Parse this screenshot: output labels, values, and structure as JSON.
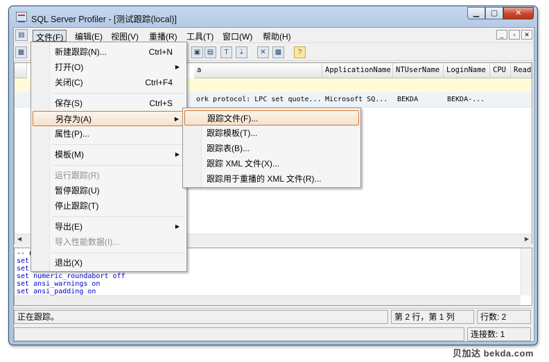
{
  "window": {
    "title": "SQL Server Profiler - [测试跟踪(local)]"
  },
  "menubar": {
    "items": [
      "文件(F)",
      "编辑(E)",
      "视图(V)",
      "重播(R)",
      "工具(T)",
      "窗口(W)",
      "帮助(H)"
    ]
  },
  "grid": {
    "columns": [
      "a",
      "ApplicationName",
      "NTUserName",
      "LoginName",
      "CPU",
      "Read"
    ],
    "row": [
      "ork protocol: LPC  set quote...",
      "Microsoft SQ...",
      "BEKDA",
      "BEKDA-..."
    ]
  },
  "text_pane": {
    "lines": [
      {
        "kw": "set",
        "rest": ""
      },
      {
        "kw": "set",
        "rest": ""
      },
      {
        "kw": "set",
        "rest": "numeric_roundabort off"
      },
      {
        "kw": "set",
        "rest": "ansi_warnings on"
      },
      {
        "kw": "set",
        "rest": "ansi_padding on"
      }
    ],
    "first_line": "-- n"
  },
  "status": {
    "text": "正在跟踪。",
    "position": "第 2 行，第 1 列",
    "rows": "行数: 2",
    "connections": "连接数: 1"
  },
  "file_menu": {
    "items": [
      {
        "label": "新建跟踪(N)...",
        "shortcut": "Ctrl+N"
      },
      {
        "label": "打开(O)",
        "shortcut": ""
      },
      {
        "label": "关闭(C)",
        "shortcut": "Ctrl+F4"
      },
      {
        "label": "保存(S)",
        "shortcut": "Ctrl+S"
      },
      {
        "label": "另存为(A)",
        "shortcut": ""
      },
      {
        "label": "属性(P)...",
        "shortcut": ""
      },
      {
        "label": "模板(M)",
        "shortcut": ""
      },
      {
        "label": "运行跟踪(R)",
        "shortcut": ""
      },
      {
        "label": "暂停跟踪(U)",
        "shortcut": ""
      },
      {
        "label": "停止跟踪(T)",
        "shortcut": ""
      },
      {
        "label": "导出(E)",
        "shortcut": ""
      },
      {
        "label": "导入性能数据(I)...",
        "shortcut": ""
      },
      {
        "label": "退出(X)",
        "shortcut": ""
      }
    ]
  },
  "saveas_menu": {
    "items": [
      "跟踪文件(F)...",
      "跟踪模板(T)...",
      "跟踪表(B)...",
      "跟踪 XML 文件(X)...",
      "跟踪用于重播的 XML 文件(R)..."
    ]
  },
  "watermark": "贝加达 bekda.com",
  "colors": {
    "highlight_border": "#e0741d",
    "keyword": "#0000c8",
    "close_button": "#c8462f"
  }
}
